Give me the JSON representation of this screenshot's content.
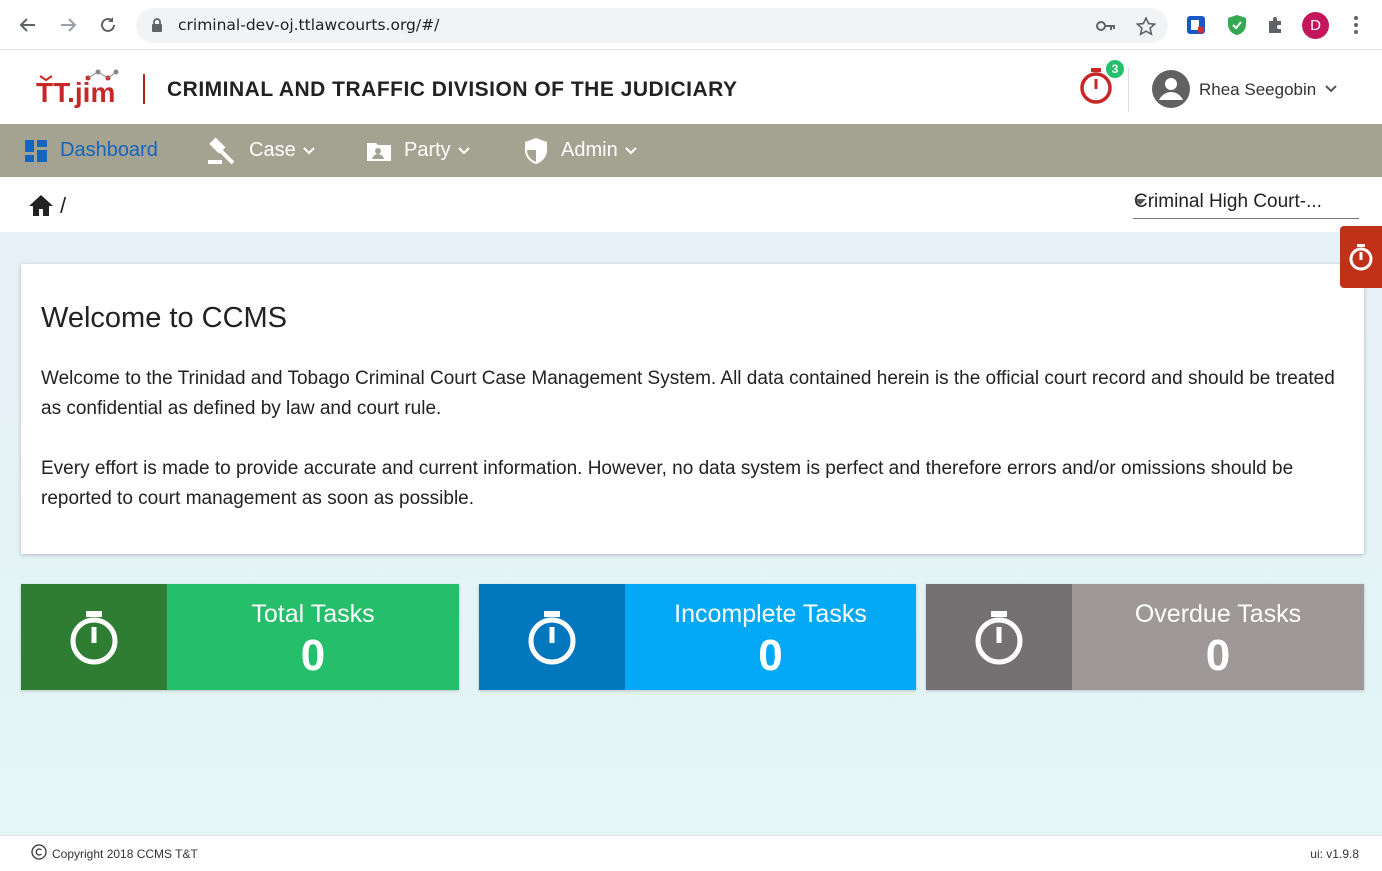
{
  "browser": {
    "url": "criminal-dev-oj.ttlawcourts.org/#/",
    "profile_initial": "D"
  },
  "header": {
    "logo_text": "TT.jim",
    "division_title": "CRIMINAL AND TRAFFIC DIVISION OF THE JUDICIARY",
    "timer_badge_count": "3",
    "user_name": "Rhea Seegobin"
  },
  "nav": {
    "items": [
      {
        "label": "Dashboard",
        "icon": "dashboard-icon",
        "active": true
      },
      {
        "label": "Case",
        "icon": "gavel-icon"
      },
      {
        "label": "Party",
        "icon": "contact-card-icon"
      },
      {
        "label": "Admin",
        "icon": "shield-icon"
      }
    ]
  },
  "breadcrumb": {
    "separator": "/"
  },
  "court_select": {
    "value": "Criminal High Court-..."
  },
  "welcome": {
    "title": "Welcome to CCMS",
    "paragraph1": "Welcome to the Trinidad and Tobago Criminal Court Case Management System. All data contained herein is the official court record and should be treated as confidential as defined by law and court rule.",
    "paragraph2": "Every effort is made to provide accurate and current information. However, no data system is perfect and therefore errors and/or omissions should be reported to court management as soon as possible."
  },
  "tiles": [
    {
      "label": "Total Tasks",
      "count": "0",
      "icon_bg": "#2e7d32",
      "bg": "#25be6a"
    },
    {
      "label": "Incomplete Tasks",
      "count": "0",
      "icon_bg": "#0277bd",
      "bg": "#03a9f4"
    },
    {
      "label": "Overdue Tasks",
      "count": "0",
      "icon_bg": "#757071",
      "bg": "#9e9898"
    }
  ],
  "footer": {
    "copyright": "Copyright 2018  CCMS T&T",
    "version": "ui: v1.9.8"
  }
}
